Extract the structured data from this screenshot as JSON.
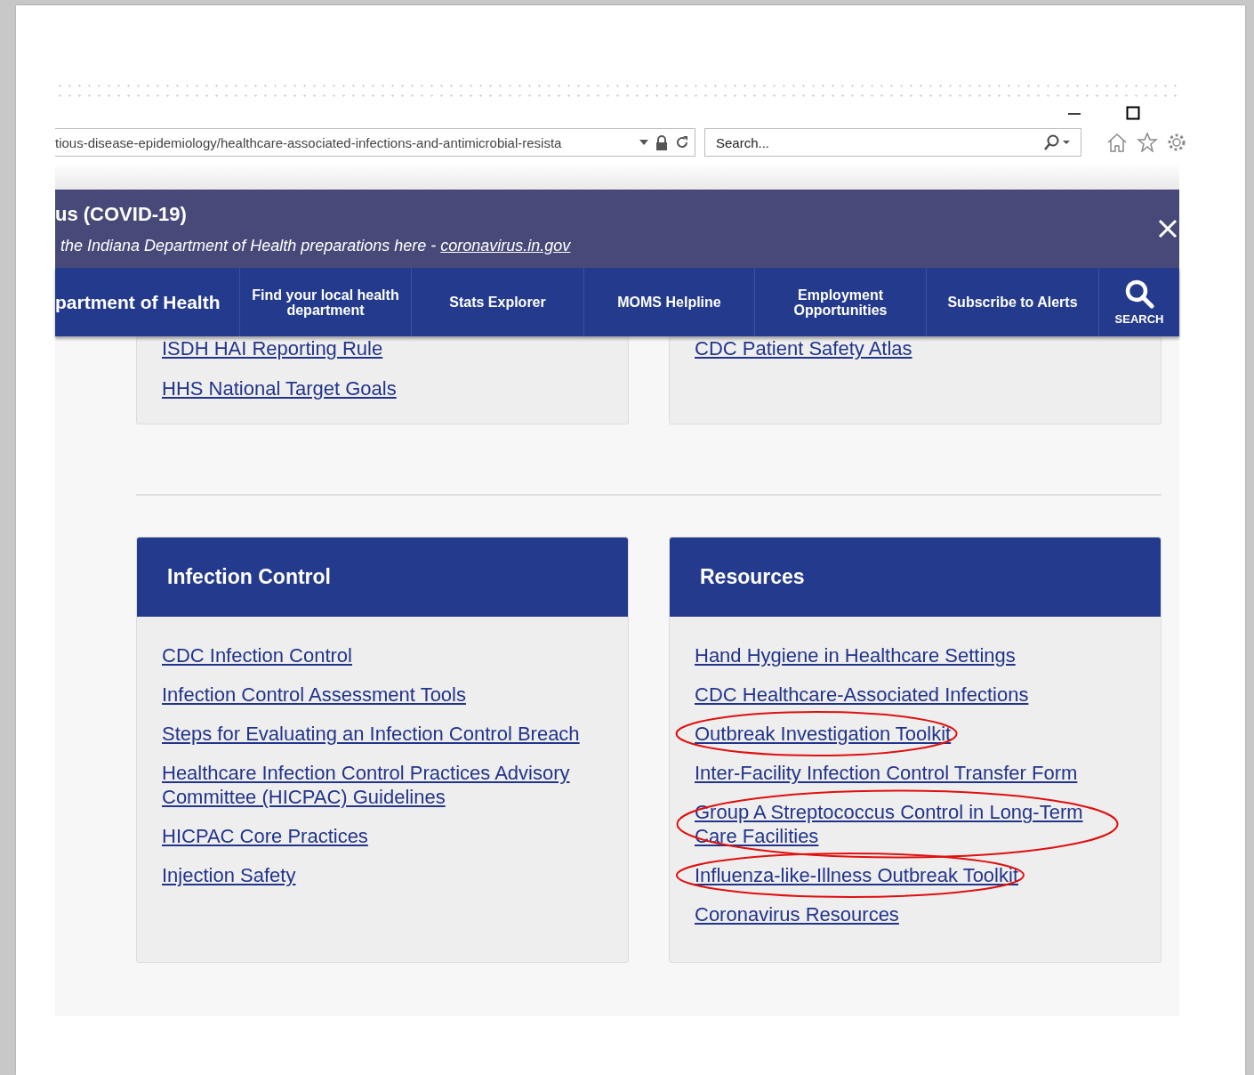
{
  "browser": {
    "address": "tious-disease-epidemiology/healthcare-associated-infections-and-antimicrobial-resista",
    "search_placeholder": "Search..."
  },
  "alert": {
    "title": "us (COVID-19)",
    "text": "the Indiana Department of Health preparations here - ",
    "link": "coronavirus.in.gov"
  },
  "nav": {
    "items": [
      {
        "label": "partment of Health",
        "kind": "brand"
      },
      {
        "label": "Find your local health department",
        "kind": "link"
      },
      {
        "label": "Stats Explorer",
        "kind": "link"
      },
      {
        "label": "MOMS Helpline",
        "kind": "link"
      },
      {
        "label": "Employment Opportunities",
        "kind": "link"
      },
      {
        "label": "Subscribe to Alerts",
        "kind": "link"
      },
      {
        "label": "SEARCH",
        "kind": "search"
      }
    ]
  },
  "top_cards": [
    {
      "links": [
        "ISDH HAI Reporting Rule",
        "HHS National Target Goals"
      ]
    },
    {
      "links": [
        "CDC Patient Safety Atlas"
      ]
    }
  ],
  "sections": [
    {
      "title": "Infection Control",
      "links": [
        {
          "label": "CDC Infection Control",
          "circled": false
        },
        {
          "label": "Infection Control Assessment Tools",
          "circled": false
        },
        {
          "label": "Steps for Evaluating an Infection Control Breach",
          "circled": false
        },
        {
          "label": "Healthcare Infection Control Practices Advisory Committee (HICPAC) Guidelines",
          "circled": false
        },
        {
          "label": "HICPAC Core Practices",
          "circled": false
        },
        {
          "label": "Injection Safety",
          "circled": false
        }
      ]
    },
    {
      "title": "Resources",
      "links": [
        {
          "label": "Hand Hygiene in Healthcare Settings",
          "circled": false
        },
        {
          "label": "CDC Healthcare-Associated Infections",
          "circled": false
        },
        {
          "label": "Outbreak Investigation Toolkit",
          "circled": true
        },
        {
          "label": "Inter-Facility Infection Control Transfer Form",
          "circled": false
        },
        {
          "label": "Group A Streptococcus Control in Long-Term Care Facilities",
          "circled": true
        },
        {
          "label": "Influenza-like-Illness Outbreak Toolkit",
          "circled": true
        },
        {
          "label": "Coronavirus Resources",
          "circled": false
        }
      ]
    }
  ]
}
